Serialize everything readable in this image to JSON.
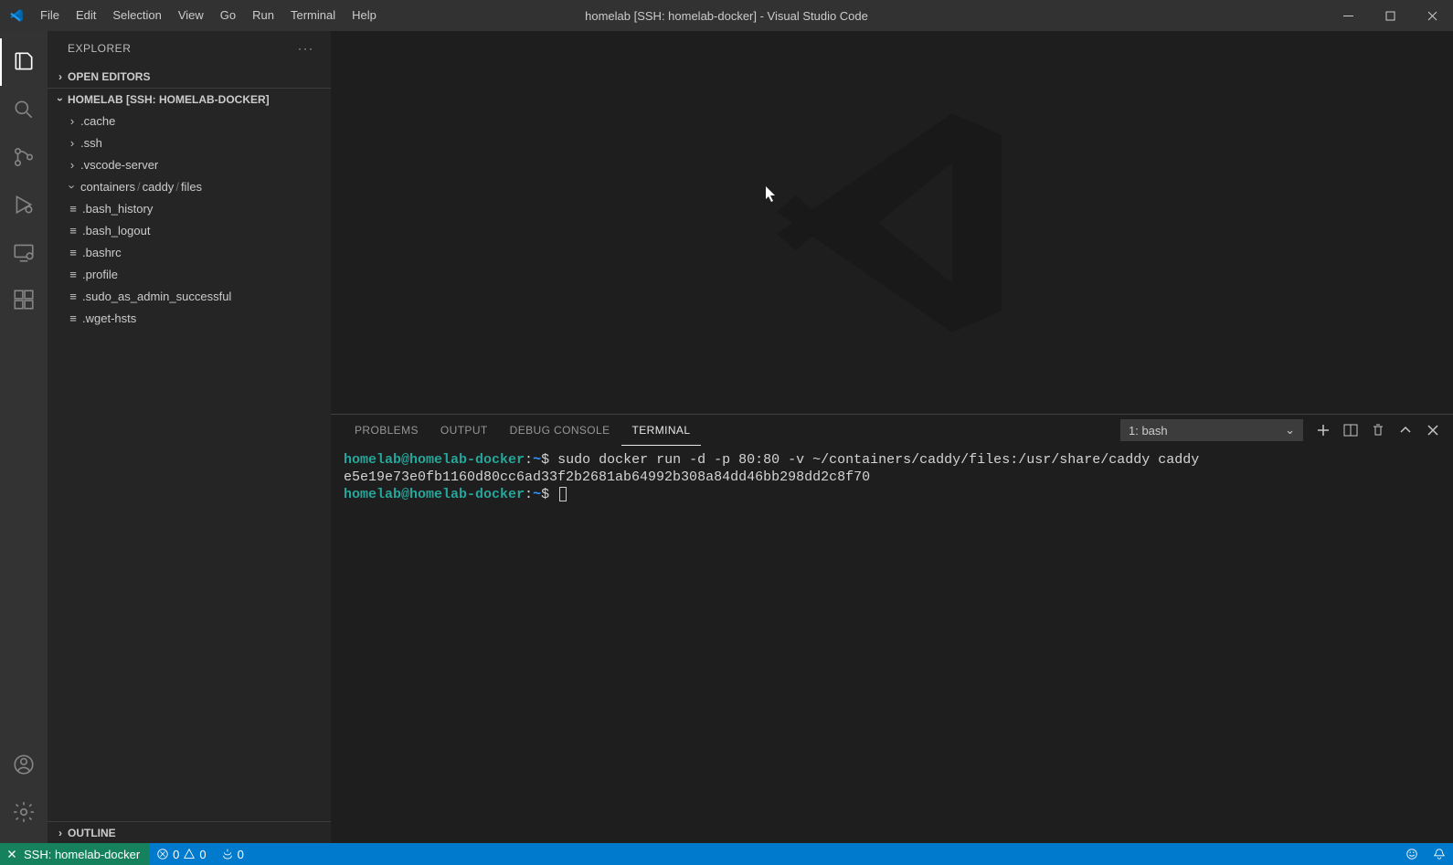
{
  "title": "homelab [SSH: homelab-docker] - Visual Studio Code",
  "menu": [
    "File",
    "Edit",
    "Selection",
    "View",
    "Go",
    "Run",
    "Terminal",
    "Help"
  ],
  "sidebar": {
    "title": "EXPLORER",
    "open_editors": "OPEN EDITORS",
    "workspace": "HOMELAB [SSH: HOMELAB-DOCKER]",
    "outline": "OUTLINE",
    "folders": [
      ".cache",
      ".ssh",
      ".vscode-server"
    ],
    "nested_path": [
      "containers",
      "caddy",
      "files"
    ],
    "files": [
      ".bash_history",
      ".bash_logout",
      ".bashrc",
      ".profile",
      ".sudo_as_admin_successful",
      ".wget-hsts"
    ]
  },
  "panel": {
    "tabs": [
      "PROBLEMS",
      "OUTPUT",
      "DEBUG CONSOLE",
      "TERMINAL"
    ],
    "active_tab": "TERMINAL",
    "terminal_select": "1: bash",
    "terminal": {
      "prompt_user": "homelab@homelab-docker",
      "prompt_sep": ":",
      "prompt_path": "~",
      "prompt_symbol": "$",
      "command": "sudo docker run -d -p 80:80 -v ~/containers/caddy/files:/usr/share/caddy caddy",
      "output": "e5e19e73e0fb1160d80cc6ad33f2b2681ab64992b308a84dd46bb298dd2c8f70"
    }
  },
  "status": {
    "remote": "SSH: homelab-docker",
    "errors": "0",
    "warnings": "0",
    "ports": "0"
  }
}
